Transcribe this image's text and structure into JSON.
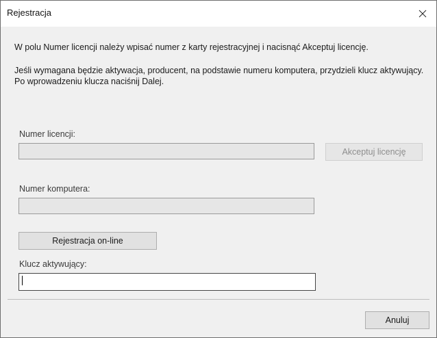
{
  "window": {
    "title": "Rejestracja",
    "close_icon": "close-icon"
  },
  "instructions": {
    "line1": "W polu Numer licencji należy wpisać numer z karty rejestracyjnej i nacisnąć Akceptuj licencję.",
    "line2": "Jeśli wymagana będzie aktywacja, producent, na podstawie numeru komputera, przydzieli klucz aktywujący. Po wprowadzeniu klucza naciśnij Dalej."
  },
  "license": {
    "label": "Numer licencji:",
    "value": "",
    "accept_button": "Akceptuj licencję"
  },
  "computer": {
    "label": "Numer komputera:",
    "value": ""
  },
  "online_button": "Rejestracja on-line",
  "activation": {
    "label": "Klucz aktywujący:",
    "value": ""
  },
  "cancel_button": "Anuluj"
}
